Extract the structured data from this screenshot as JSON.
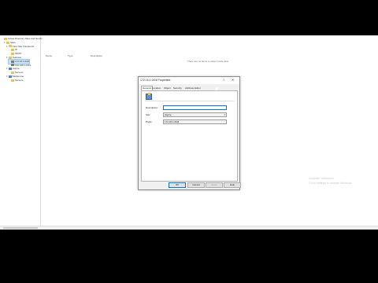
{
  "tree": {
    "items": [
      {
        "label": "Active Directory Sites and Servic",
        "indent": 0,
        "icon": "folder",
        "toggle": ""
      },
      {
        "label": "Sites",
        "indent": 1,
        "icon": "folder",
        "toggle": "▾"
      },
      {
        "label": "Inter-Site Transports",
        "indent": 2,
        "icon": "folder",
        "toggle": "▾"
      },
      {
        "label": "IP",
        "indent": 3,
        "icon": "folder",
        "toggle": ""
      },
      {
        "label": "SMTP",
        "indent": 3,
        "icon": "folder",
        "toggle": ""
      },
      {
        "label": "Subnets",
        "indent": 2,
        "icon": "folder",
        "toggle": "▾"
      },
      {
        "label": "172.16.1.0/24",
        "indent": 3,
        "icon": "subnet",
        "toggle": "",
        "selected": true
      },
      {
        "label": "192.168.1.0/24",
        "indent": 3,
        "icon": "subnet",
        "toggle": ""
      },
      {
        "label": "Aspire",
        "indent": 2,
        "icon": "site",
        "toggle": "▾"
      },
      {
        "label": "Servers",
        "indent": 3,
        "icon": "folder",
        "toggle": ""
      },
      {
        "label": "Melbourne",
        "indent": 2,
        "icon": "site",
        "toggle": "▾"
      },
      {
        "label": "Servers",
        "indent": 3,
        "icon": "folder",
        "toggle": ""
      }
    ]
  },
  "list": {
    "columns": [
      "Name",
      "Type",
      "Description"
    ],
    "empty_message": "There are no items to show in this view."
  },
  "dialog": {
    "title": "172.16.1.0/24 Properties",
    "help": "?",
    "close": "✕",
    "tabs": [
      "General",
      "Location",
      "Object",
      "Security",
      "Attribute Editor"
    ],
    "active_tab": "General",
    "fields": {
      "description_label": "Description:",
      "description_value": "",
      "site_label": "Site:",
      "site_value": "Aspire",
      "prefix_label": "Prefix:",
      "prefix_value": "172.16.1.0/24"
    },
    "buttons": {
      "ok": "OK",
      "cancel": "Cancel",
      "apply": "Apply",
      "help": "Help"
    }
  },
  "watermark": {
    "line1": "Activate Windows",
    "line2": "Go to Settings to activate Windows."
  }
}
